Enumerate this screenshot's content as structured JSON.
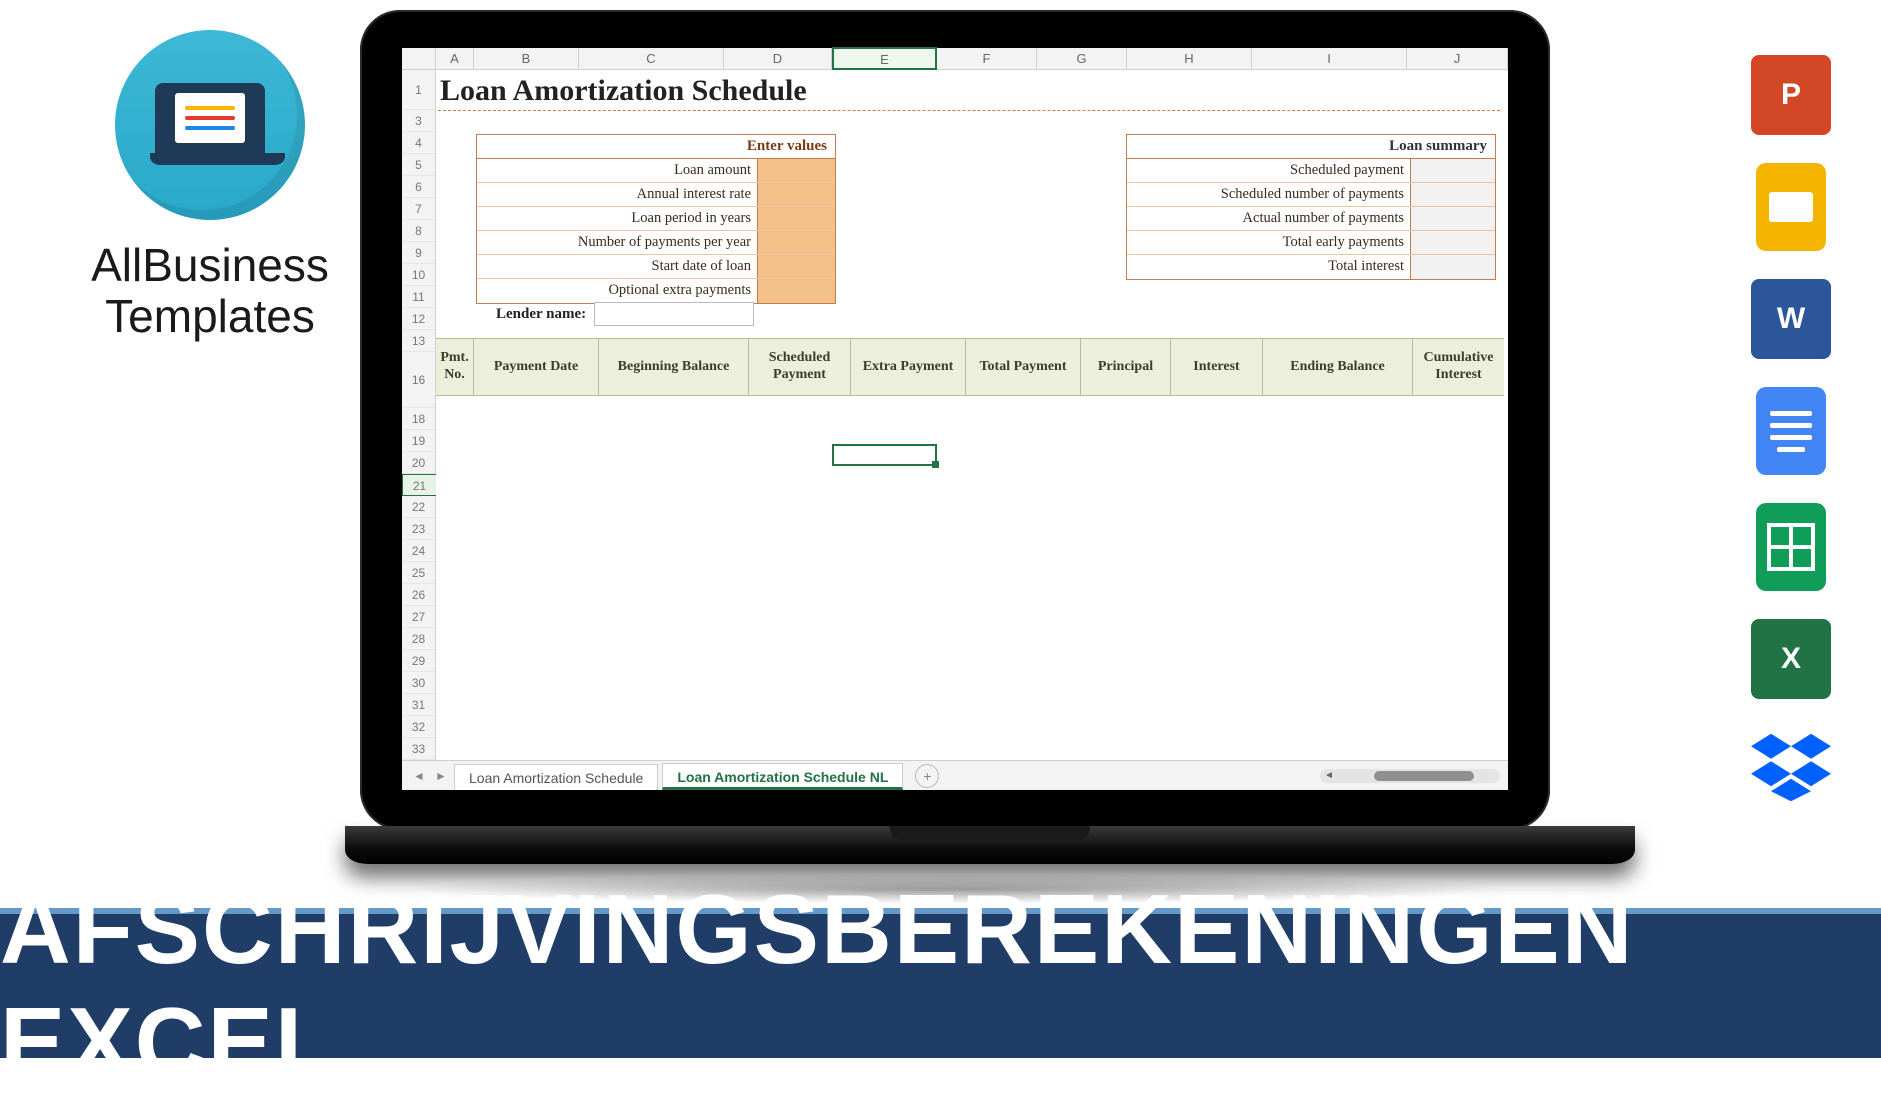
{
  "brand": {
    "line1": "AllBusiness",
    "line2": "Templates"
  },
  "banner": {
    "text": "AFSCHRIJVINGSBEREKENINGEN EXCEL"
  },
  "apps": {
    "powerpoint": "P",
    "word": "W",
    "excel": "X"
  },
  "spreadsheet": {
    "columns": [
      "A",
      "B",
      "C",
      "D",
      "E",
      "F",
      "G",
      "H",
      "I",
      "J"
    ],
    "rows_left": [
      "1",
      "3",
      "4",
      "5",
      "6",
      "7",
      "8",
      "9",
      "10",
      "11",
      "12",
      "13"
    ],
    "rows_body": [
      "16",
      "18",
      "19",
      "20",
      "21",
      "22",
      "23",
      "24",
      "25",
      "26",
      "27",
      "28",
      "29",
      "30",
      "31",
      "32",
      "33"
    ],
    "selected_cell_col": "E",
    "selected_cell_row": "21",
    "title": "Loan Amortization Schedule",
    "enter_values": {
      "header": "Enter values",
      "fields": [
        "Loan amount",
        "Annual interest rate",
        "Loan period in years",
        "Number of payments per year",
        "Start date of loan",
        "Optional extra payments"
      ]
    },
    "loan_summary": {
      "header": "Loan summary",
      "fields": [
        "Scheduled payment",
        "Scheduled number of payments",
        "Actual number of payments",
        "Total early payments",
        "Total interest"
      ]
    },
    "lender_label": "Lender name:",
    "schedule_headers": [
      "Pmt. No.",
      "Payment Date",
      "Beginning Balance",
      "Scheduled Payment",
      "Extra Payment",
      "Total Payment",
      "Principal",
      "Interest",
      "Ending Balance",
      "Cumulative Interest"
    ],
    "tabs": {
      "tab1": "Loan Amortization Schedule",
      "tab2": "Loan Amortization Schedule NL",
      "add": "+"
    }
  }
}
